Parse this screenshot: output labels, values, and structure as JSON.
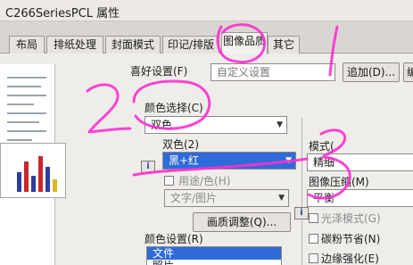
{
  "window": {
    "title": "C266SeriesPCL 属性"
  },
  "tabs": [
    {
      "label": "布局"
    },
    {
      "label": "排纸处理"
    },
    {
      "label": "封面模式"
    },
    {
      "label": "印记/排版"
    },
    {
      "label": "图像品质"
    },
    {
      "label": "其它"
    }
  ],
  "favorites": {
    "label": "喜好设置(F)",
    "value": "自定义设置",
    "add_button": "追加(D)...",
    "edit_button_partial": "编"
  },
  "color_select": {
    "label": "颜色选择(C)",
    "value": "双色"
  },
  "two_color": {
    "label": "双色(2)",
    "value": "黑+红"
  },
  "application_color": {
    "label": "用途/色(H)",
    "value": "文字/图片"
  },
  "image_adjust_button": "画质调整(Q)...",
  "color_settings": {
    "label": "颜色设置(R)",
    "items": [
      "文件",
      "照片"
    ]
  },
  "right_panel": {
    "mode_label": "模式(",
    "mode_value": "精细",
    "compress_label": "图像压缩(M)",
    "compress_value": "平衡",
    "gloss_label": "光泽模式(G)",
    "toner_save_label": "碳粉节省(N)",
    "edge_label": "边缘强化(E)"
  },
  "colors": {
    "annotation": "#ff2fd0",
    "selection": "#2f6bd8"
  },
  "icons": {
    "info": "i"
  }
}
